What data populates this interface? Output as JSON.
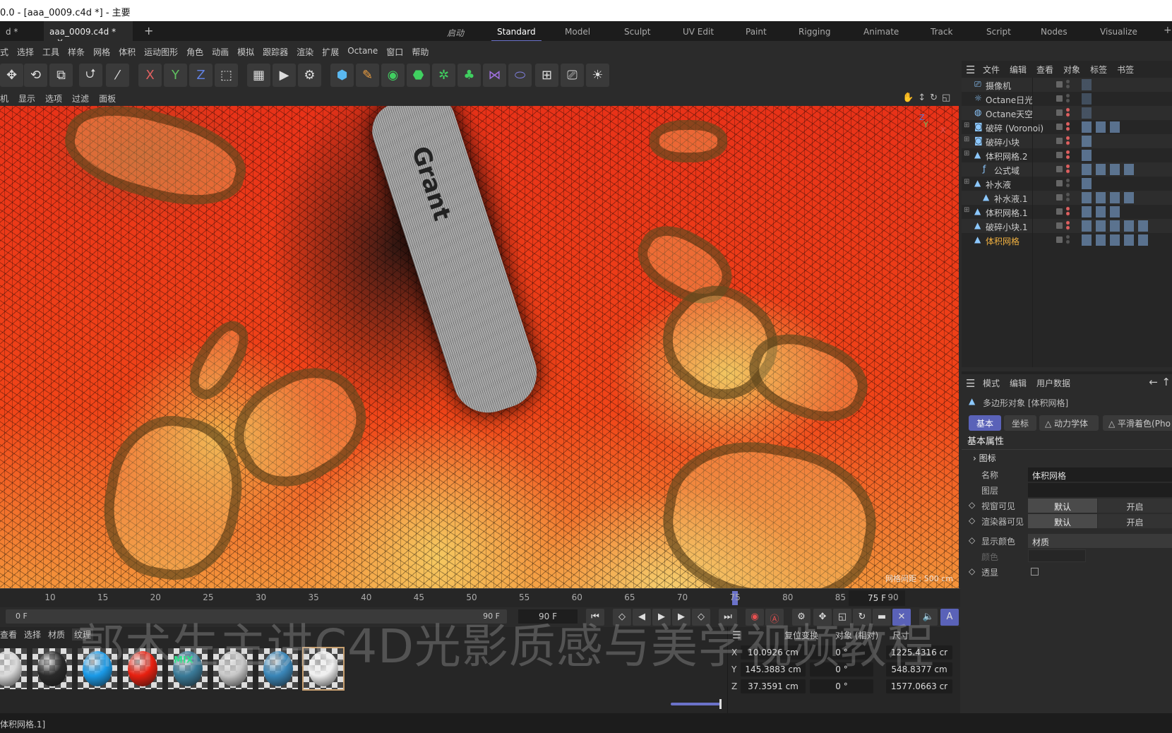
{
  "title": "0.0 - [aaa_0009.c4d *] - 主要",
  "doc_tabs": [
    {
      "label": "d *"
    },
    {
      "label": "aaa_0009.c4d *",
      "close": "×"
    }
  ],
  "add_tab": "+",
  "layouts": [
    "启动",
    "Standard",
    "Model",
    "Sculpt",
    "UV Edit",
    "Paint",
    "Rigging",
    "Animate",
    "Track",
    "Script",
    "Nodes",
    "Visualize"
  ],
  "active_layout": "Standard",
  "menu": [
    "式",
    "选择",
    "工具",
    "样条",
    "网格",
    "体积",
    "运动图形",
    "角色",
    "动画",
    "模拟",
    "跟踪器",
    "渲染",
    "扩展",
    "Octane",
    "窗口",
    "帮助"
  ],
  "toolbar": [
    {
      "icon": "move-icon",
      "g": "✥"
    },
    {
      "icon": "rotate-icon",
      "g": "⟲"
    },
    {
      "icon": "scale-icon",
      "g": "⧉"
    },
    {
      "icon": "undo-transform-icon",
      "g": "⮍"
    },
    {
      "icon": "brush-icon",
      "g": "⁄"
    },
    {
      "icon": "x-axis-icon",
      "g": "X"
    },
    {
      "icon": "y-axis-icon",
      "g": "Y"
    },
    {
      "icon": "z-axis-icon",
      "g": "Z"
    },
    {
      "icon": "coordinate-system-icon",
      "g": "⬚"
    },
    {
      "icon": "render-view-icon",
      "g": "▦"
    },
    {
      "icon": "render-picture-viewer-icon",
      "g": "▶"
    },
    {
      "icon": "render-settings-icon",
      "g": "⚙"
    },
    {
      "icon": "cube-icon",
      "g": "⬢"
    },
    {
      "icon": "pen-icon",
      "g": "✎"
    },
    {
      "icon": "subdivision-icon",
      "g": "◉"
    },
    {
      "icon": "extrude-icon",
      "g": "⬣"
    },
    {
      "icon": "cloner-icon",
      "g": "✲"
    },
    {
      "icon": "voronoi-icon",
      "g": "♣"
    },
    {
      "icon": "deformer-icon",
      "g": "⋈"
    },
    {
      "icon": "field-icon",
      "g": "⬭"
    },
    {
      "icon": "floor-icon",
      "g": "⊞"
    },
    {
      "icon": "camera-icon",
      "g": "⎚"
    },
    {
      "icon": "light-icon",
      "g": "☀"
    }
  ],
  "viewport_menu": [
    "机",
    "显示",
    "选项",
    "过滤",
    "面板"
  ],
  "viewport": {
    "tube_text": "Grant",
    "grid_label": "网格间距 : 500 cm",
    "axis": {
      "x": "X",
      "y": "Y",
      "z": "Z"
    }
  },
  "timeline": {
    "ticks": [
      10,
      15,
      20,
      25,
      30,
      35,
      40,
      45,
      50,
      55,
      60,
      65,
      70,
      75,
      80,
      85,
      90
    ],
    "current_frame": 75,
    "current_label": "75 F",
    "start": "0 F",
    "end": "90 F",
    "end_field": "90 F"
  },
  "material_menu": [
    "查看",
    "选择",
    "材质",
    "纹理"
  ],
  "materials": [
    {
      "color": "#d8d8d8"
    },
    {
      "color": "#2a2a2a"
    },
    {
      "color": "#1a9ae8"
    },
    {
      "color": "#e82010"
    },
    {
      "color": "#3a7a98",
      "label": "MIX"
    },
    {
      "color": "#c8c8c8"
    },
    {
      "color": "#3a86b8"
    },
    {
      "color": "#f0f0f0",
      "selected": true
    }
  ],
  "coords": {
    "header": [
      "复位变换",
      "对象 (相对)",
      "尺寸"
    ],
    "rows": [
      {
        "axis": "X",
        "pos": "10.0926 cm",
        "rot": "0 °",
        "size": "1225.4316 cr"
      },
      {
        "axis": "Y",
        "pos": "145.3883 cm",
        "rot": "0 °",
        "size": "548.8377 cm"
      },
      {
        "axis": "Z",
        "pos": "37.3591 cm",
        "rot": "0 °",
        "size": "1577.0663 cr"
      }
    ]
  },
  "status": "体积网格.1]",
  "watermark": "郭术生主讲C4D光影质感与美学视频教程",
  "object_manager": {
    "menu": [
      "文件",
      "编辑",
      "查看",
      "对象",
      "标签",
      "书签"
    ],
    "objects": [
      {
        "name": "摄像机",
        "indent": 0,
        "icon": "camera-icon",
        "dots": "grey"
      },
      {
        "name": "Octane日光",
        "indent": 0,
        "icon": "sun-light-icon",
        "dots": "grey"
      },
      {
        "name": "Octane天空",
        "indent": 0,
        "icon": "sky-icon",
        "dots": "red"
      },
      {
        "name": "破碎 (Voronoi)",
        "indent": 0,
        "icon": "voronoi-icon",
        "dots": "red",
        "expand": "+"
      },
      {
        "name": "破碎小块",
        "indent": 0,
        "icon": "voronoi-icon",
        "dots": "red",
        "expand": "+"
      },
      {
        "name": "体积网格.2",
        "indent": 0,
        "icon": "volume-mesher-icon",
        "dots": "red",
        "expand": "−"
      },
      {
        "name": "公式域",
        "indent": 1,
        "icon": "formula-field-icon",
        "dots": "red"
      },
      {
        "name": "补水液",
        "indent": 0,
        "icon": "volume-mesher-icon",
        "dots": "grey",
        "expand": "−"
      },
      {
        "name": "补水液.1",
        "indent": 1,
        "icon": "volume-mesher-icon",
        "dots": "grey"
      },
      {
        "name": "体积网格.1",
        "indent": 0,
        "icon": "volume-mesher-icon",
        "dots": "red",
        "expand": "+"
      },
      {
        "name": "破碎小块.1",
        "indent": 0,
        "icon": "volume-mesher-icon",
        "dots": "red"
      },
      {
        "name": "体积网格",
        "indent": 0,
        "icon": "volume-mesher-icon",
        "dots": "grey",
        "selected": true
      }
    ]
  },
  "attribute_manager": {
    "menu": [
      "模式",
      "编辑",
      "用户数据"
    ],
    "object_title": "多边形对象 [体积网格]",
    "tabs": [
      "基本",
      "坐标",
      "动力学体",
      "平滑着色(Pho"
    ],
    "section": "基本属性",
    "group": "图标",
    "fields": {
      "name_label": "名称",
      "name_value": "体积网格",
      "layer_label": "图层",
      "viewport_visible": "视窗可见",
      "render_visible": "渲染器可见",
      "default": "默认",
      "on": "开启",
      "display_color": "显示颜色",
      "display_color_value": "材质",
      "color": "颜色",
      "xray": "透显"
    }
  },
  "colors": {
    "accent": "#6b72c9",
    "selected_object": "#f0b040"
  }
}
